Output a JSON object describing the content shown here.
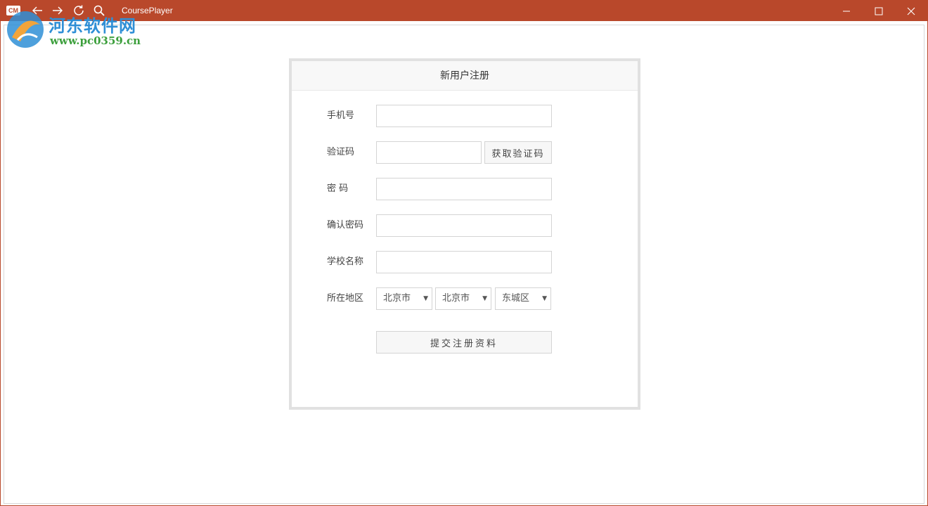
{
  "window": {
    "title": "CoursePlayer",
    "logo_text": "CM",
    "accent_color": "#b9482b"
  },
  "watermark": {
    "title": "河东软件网",
    "url": "www.pc0359.cn"
  },
  "form": {
    "title": "新用户注册",
    "phone_label": "手机号",
    "phone_value": "",
    "code_label": "验证码",
    "code_value": "",
    "get_code_label": "获取验证码",
    "password_label": "密 码",
    "password_value": "",
    "confirm_label": "确认密码",
    "confirm_value": "",
    "school_label": "学校名称",
    "school_value": "",
    "region_label": "所在地区",
    "province": "北京市",
    "city": "北京市",
    "district": "东城区",
    "submit_label": "提交注册资料"
  },
  "icons": {
    "back": "arrow-left-icon",
    "forward": "arrow-right-icon",
    "refresh": "refresh-icon",
    "search": "search-icon",
    "minimize": "minimize-icon",
    "maximize": "maximize-icon",
    "close": "close-icon"
  }
}
